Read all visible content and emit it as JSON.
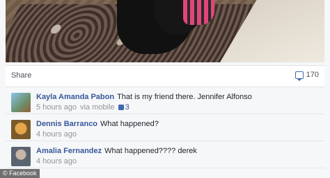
{
  "bar": {
    "share_label": "Share",
    "comment_count": "170"
  },
  "comments": [
    {
      "name": "Kayla Amanda Pabon",
      "text": "That is my friend there. Jennifer Alfonso",
      "time": "5 hours ago",
      "via": "via mobile",
      "likes": "3"
    },
    {
      "name": "Dennis Barranco",
      "text": "What happened?",
      "time": "4 hours ago"
    },
    {
      "name": "Amalia Fernandez",
      "text": "What happened???? derek",
      "time": "4 hours ago"
    }
  ],
  "watermark": "© Facebook",
  "icons": {
    "comment_count": "comment-icon",
    "like": "thumbs-up-icon"
  },
  "colors": {
    "link": "#365899",
    "meta": "#90949c",
    "brand": "#4267b2"
  }
}
